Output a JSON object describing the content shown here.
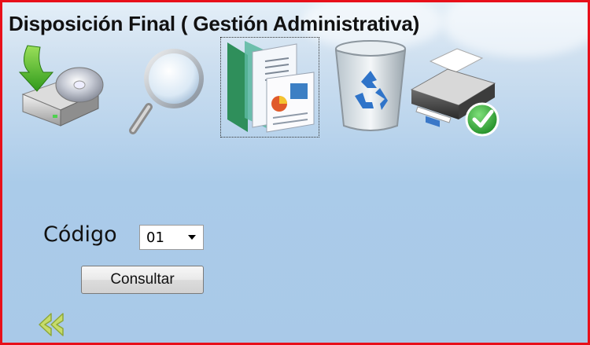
{
  "header": {
    "title": "Disposición Final ( Gestión Administrativa)"
  },
  "toolbar": {
    "items": [
      {
        "icon": "download-to-drive-icon"
      },
      {
        "icon": "magnifier-icon"
      },
      {
        "icon": "documents-icon",
        "focused": true
      },
      {
        "icon": "recycle-bin-icon"
      },
      {
        "icon": "printer-icon"
      }
    ]
  },
  "form": {
    "codigo_label": "Código",
    "codigo_value": "01",
    "consultar_label": "Consultar"
  },
  "nav": {
    "back_icon": "double-left-arrow-icon"
  },
  "colors": {
    "border": "#e8101a",
    "background": "#a9c9e8",
    "back_arrow": "#c7dc6a"
  }
}
